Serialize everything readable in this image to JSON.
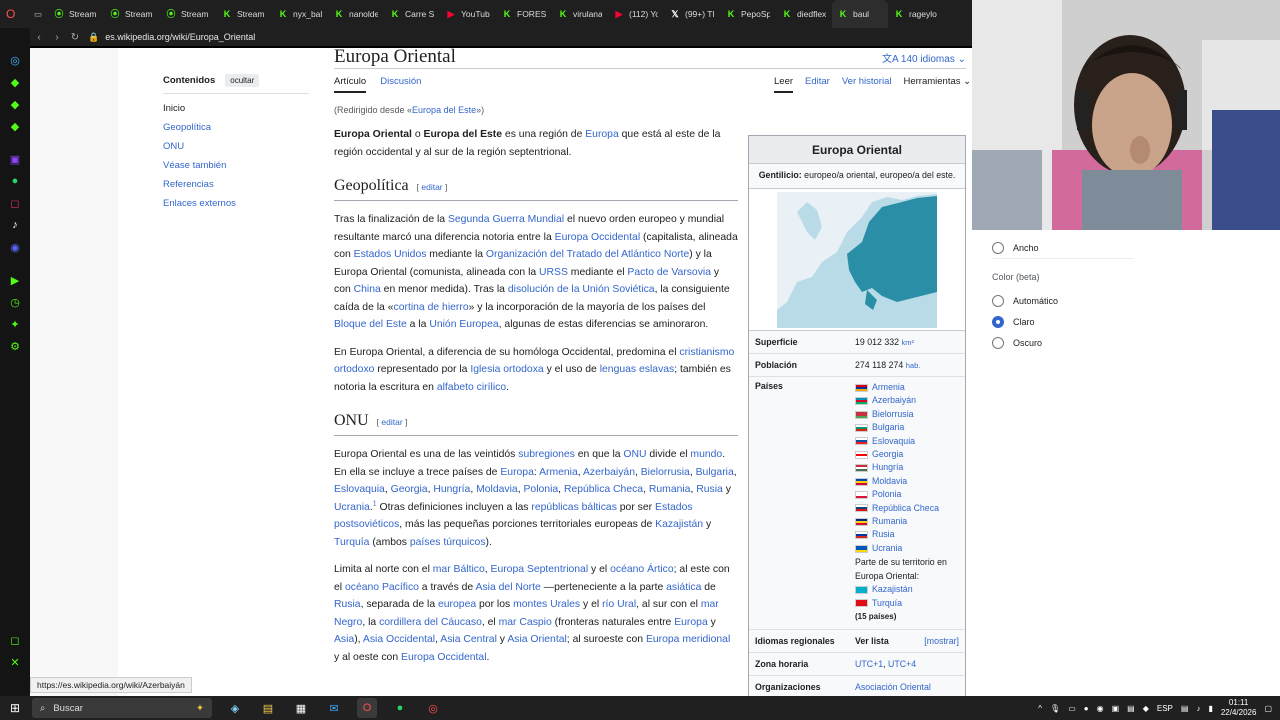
{
  "browser": {
    "tabs": [
      {
        "label": "Stream",
        "icon": "stream-icon",
        "color": "#53fc18"
      },
      {
        "label": "Stream",
        "icon": "stream-icon",
        "color": "#53fc18"
      },
      {
        "label": "Stream",
        "icon": "stream-icon",
        "color": "#53fc18"
      },
      {
        "label": "Stream",
        "icon": "kick-icon",
        "color": "#53fc18"
      },
      {
        "label": "nyx_bal",
        "icon": "kick-icon",
        "color": "#53fc18"
      },
      {
        "label": "nanolde",
        "icon": "kick-icon",
        "color": "#53fc18"
      },
      {
        "label": "Carre S",
        "icon": "kick-icon",
        "color": "#53fc18"
      },
      {
        "label": "YouTub",
        "icon": "youtube-icon",
        "color": "#ff0033"
      },
      {
        "label": "FOREST",
        "icon": "kick-icon",
        "color": "#53fc18"
      },
      {
        "label": "virulana",
        "icon": "kick-icon",
        "color": "#53fc18"
      },
      {
        "label": "(112) Yo",
        "icon": "youtube-icon",
        "color": "#ff0033"
      },
      {
        "label": "(99+) Tl",
        "icon": "twitter-icon",
        "color": "#ffffff"
      },
      {
        "label": "PepoSp",
        "icon": "kick-icon",
        "color": "#53fc18"
      },
      {
        "label": "diedflex",
        "icon": "kick-icon",
        "color": "#53fc18"
      },
      {
        "label": "baul",
        "icon": "kick-icon",
        "color": "#53fc18"
      },
      {
        "label": "rageylo",
        "icon": "kick-icon",
        "color": "#53fc18"
      }
    ],
    "url": "es.wikipedia.org/wiki/Europa_Oriental",
    "status_url": "https://es.wikipedia.org/wiki/Azerbaiyán"
  },
  "page": {
    "title": "Europa Oriental",
    "languages": "140 idiomas",
    "tab_article": "Artículo",
    "tab_discussion": "Discusión",
    "tab_read": "Leer",
    "tab_edit": "Editar",
    "tab_history": "Ver historial",
    "tab_tools": "Herramientas",
    "redirect_prefix": "(Redirigido desde «",
    "redirect_link": "Europa del Este",
    "redirect_suffix": "»)"
  },
  "toc": {
    "heading": "Contenidos",
    "hide_label": "ocultar",
    "items": [
      "Inicio",
      "Geopolítica",
      "ONU",
      "Véase también",
      "Referencias",
      "Enlaces externos"
    ]
  },
  "sections": {
    "edit_label": "editar",
    "geopolitica": "Geopolítica",
    "onu": "ONU"
  },
  "infobox": {
    "title": "Europa Oriental",
    "gentilicio_label": "Gentilicio:",
    "gentilicio_value": "europeo/a oriental, europeo/a del este.",
    "superficie_label": "Superficie",
    "superficie_value": "19 012 332",
    "superficie_unit": "km²",
    "poblacion_label": "Población",
    "poblacion_value": "274 118 274",
    "poblacion_unit": "hab.",
    "paises_label": "Países",
    "countries": [
      {
        "name": "Armenia",
        "flag": [
          "#d90012",
          "#0033a0",
          "#f2a800"
        ]
      },
      {
        "name": "Azerbaiyán",
        "flag": [
          "#0092bc",
          "#e4002b",
          "#00af66"
        ]
      },
      {
        "name": "Bielorrusia",
        "flag": [
          "#c8313e",
          "#c8313e",
          "#4aa657"
        ]
      },
      {
        "name": "Bulgaria",
        "flag": [
          "#ffffff",
          "#00966e",
          "#d62612"
        ]
      },
      {
        "name": "Eslovaquia",
        "flag": [
          "#ffffff",
          "#0b4ea2",
          "#ee1c25"
        ]
      },
      {
        "name": "Georgia",
        "flag": [
          "#ffffff",
          "#ff0000",
          "#ffffff"
        ]
      },
      {
        "name": "Hungría",
        "flag": [
          "#ce2939",
          "#ffffff",
          "#477050"
        ]
      },
      {
        "name": "Moldavia",
        "flag": [
          "#0046ae",
          "#ffd200",
          "#cc092f"
        ]
      },
      {
        "name": "Polonia",
        "flag": [
          "#ffffff",
          "#ffffff",
          "#dc143c"
        ]
      },
      {
        "name": "República Checa",
        "flag": [
          "#ffffff",
          "#11457e",
          "#d7141a"
        ]
      },
      {
        "name": "Rumania",
        "flag": [
          "#002b7f",
          "#fcd116",
          "#ce1126"
        ]
      },
      {
        "name": "Rusia",
        "flag": [
          "#ffffff",
          "#0039a6",
          "#d52b1e"
        ]
      },
      {
        "name": "Ucrania",
        "flag": [
          "#0057b7",
          "#0057b7",
          "#ffd700"
        ]
      }
    ],
    "partial_note": "Parte de su territorio en Europa Oriental:",
    "partial_countries": [
      {
        "name": "Kazajistán",
        "flag": [
          "#00afca",
          "#00afca",
          "#00afca"
        ]
      },
      {
        "name": "Turquía",
        "flag": [
          "#e30a17",
          "#e30a17",
          "#e30a17"
        ]
      }
    ],
    "count_label": "(15 países)",
    "idiomas_label": "Idiomas regionales",
    "idiomas_value": "Ver lista",
    "idiomas_show": "[mostrar]",
    "zona_label": "Zona horaria",
    "zona_value_1": "UTC+1",
    "zona_value_2": "UTC+4",
    "org_label": "Organizaciones",
    "org_value": "Asociación Oriental"
  },
  "settings_panel": {
    "width_option": "Ancho",
    "color_label": "Color (beta)",
    "color_options": [
      "Automático",
      "Claro",
      "Oscuro"
    ],
    "color_selected": "Claro"
  },
  "taskbar": {
    "search_placeholder": "Buscar",
    "language": "ESP",
    "time": "01:11",
    "date": "22/4/2026"
  },
  "colors": {
    "link": "#3366cc",
    "text": "#202122",
    "kick_green": "#53fc18",
    "map_highlight": "#2a8fa6"
  }
}
